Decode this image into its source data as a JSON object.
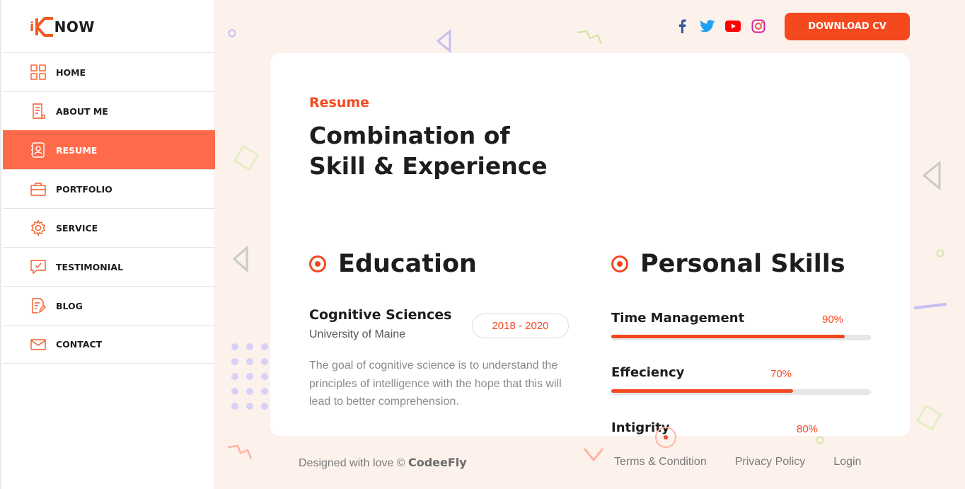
{
  "brand": {
    "logo_i": "i",
    "logo_k": "K",
    "logo_now": "NOW"
  },
  "nav": {
    "items": [
      {
        "label": "HOME",
        "icon": "grid-icon"
      },
      {
        "label": "ABOUT ME",
        "icon": "document-icon"
      },
      {
        "label": "RESUME",
        "icon": "contact-card-icon",
        "active": true
      },
      {
        "label": "PORTFOLIO",
        "icon": "briefcase-icon"
      },
      {
        "label": "SERVICE",
        "icon": "gear-icon"
      },
      {
        "label": "TESTIMONIAL",
        "icon": "chat-check-icon"
      },
      {
        "label": "BLOG",
        "icon": "edit-document-icon"
      },
      {
        "label": "CONTACT",
        "icon": "mail-icon"
      }
    ]
  },
  "header": {
    "social": [
      "facebook-icon",
      "twitter-icon",
      "youtube-icon",
      "instagram-icon"
    ],
    "cta_label": "DOWNLOAD CV"
  },
  "resume": {
    "eyebrow": "Resume",
    "headline_line1": "Combination of",
    "headline_line2": "Skill & Experience",
    "education": {
      "title": "Education",
      "degree": "Cognitive Sciences",
      "school": "University of Maine",
      "years": "2018 - 2020",
      "description": "The goal of cognitive science is to understand the principles of intelligence with the hope that this will lead to better comprehension."
    },
    "skills": {
      "title": "Personal Skills",
      "items": [
        {
          "name": "Time Management",
          "percent_label": "90%",
          "value": 0.9
        },
        {
          "name": "Effeciency",
          "percent_label": "70%",
          "value": 0.7
        },
        {
          "name": "Intigrity",
          "percent_label": "80%",
          "value": 0.8
        }
      ]
    }
  },
  "footer": {
    "credit_prefix": "Designed with love ©",
    "credit_name": "CodeeFly",
    "links": [
      "Terms & Condition",
      "Privacy Policy",
      "Login"
    ]
  },
  "colors": {
    "accent": "#f4481f",
    "active_nav": "#ff6b4a",
    "background": "#fdf1ec"
  }
}
